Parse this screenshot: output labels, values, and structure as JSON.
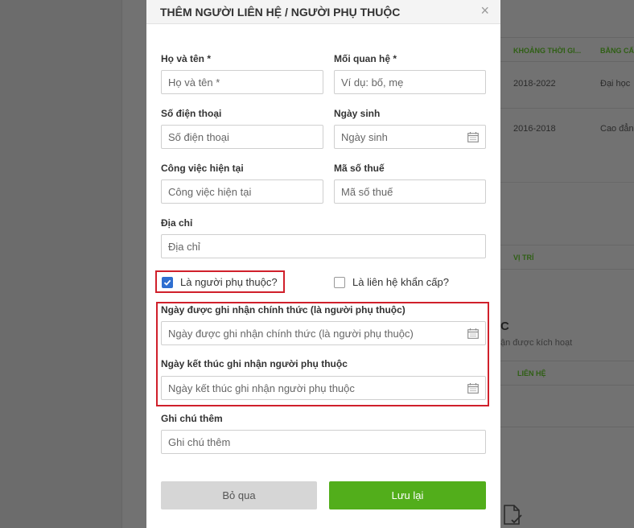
{
  "background": {
    "table_headers": [
      "KHOẢNG THỜI GI...",
      "BẰNG CẤ"
    ],
    "rows": [
      {
        "period": "2018-2022",
        "degree": "Đại học"
      },
      {
        "period": "2016-2018",
        "degree": "Cao đẳng"
      }
    ],
    "position_header": "VỊ TRÍ",
    "section_heading_fragment": "C",
    "section_sub": "ận được kích hoạt",
    "contact_header": "LIÊN HỆ"
  },
  "modal": {
    "title": "THÊM NGƯỜI LIÊN HỆ / NGƯỜI PHỤ THUỘC",
    "close_symbol": "×",
    "fields": {
      "full_name": {
        "label": "Họ và tên *",
        "placeholder": "Họ và tên *",
        "value": ""
      },
      "relationship": {
        "label": "Mối quan hệ *",
        "placeholder": "Ví dụ: bố, mẹ",
        "value": ""
      },
      "phone": {
        "label": "Số điện thoại",
        "placeholder": "Số điện thoại",
        "value": ""
      },
      "birthday": {
        "label": "Ngày sinh",
        "placeholder": "Ngày sinh",
        "value": ""
      },
      "job": {
        "label": "Công việc hiện tại",
        "placeholder": "Công việc hiện tại",
        "value": ""
      },
      "tax_code": {
        "label": "Mã số thuế",
        "placeholder": "Mã số thuế",
        "value": ""
      },
      "address": {
        "label": "Địa chỉ",
        "placeholder": "Địa chỉ",
        "value": ""
      },
      "dependent_start": {
        "label": "Ngày được ghi nhận chính thức (là người phụ thuộc)",
        "placeholder": "Ngày được ghi nhận chính thức (là người phụ thuộc)",
        "value": ""
      },
      "dependent_end": {
        "label": "Ngày kết thúc ghi nhận người phụ thuộc",
        "placeholder": "Ngày kết thúc ghi nhận người phụ thuộc",
        "value": ""
      },
      "note": {
        "label": "Ghi chú thêm",
        "placeholder": "Ghi chú thêm",
        "value": ""
      }
    },
    "checkboxes": {
      "is_dependent": {
        "label": "Là người phụ thuộc?",
        "checked": true
      },
      "is_emergency": {
        "label": "Là liên hệ khẩn cấp?",
        "checked": false
      }
    },
    "buttons": {
      "cancel": "Bỏ qua",
      "save": "Lưu lại"
    },
    "colors": {
      "primary": "#52ae1b",
      "checkbox": "#2f6fd0",
      "highlight": "#d0202b"
    }
  }
}
